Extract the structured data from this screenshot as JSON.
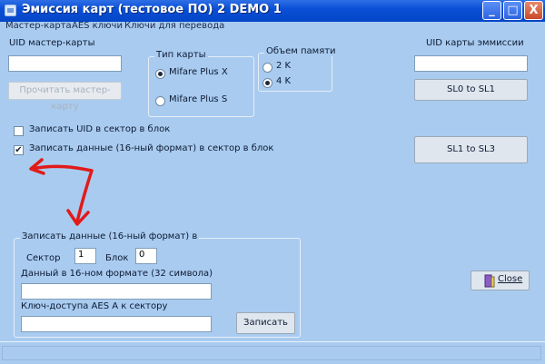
{
  "window": {
    "title": "Эмиссия карт (тестовое ПО) 2  DEMO 1",
    "minimize_glyph": "_",
    "maximize_glyph": "□",
    "close_glyph": "X"
  },
  "menu": {
    "items": [
      "Мастер-карта",
      "AES ключи",
      "Ключи для перевода"
    ]
  },
  "master": {
    "label": "UID мастер-карты",
    "value": "",
    "read_button": "Прочитать мастер-карту"
  },
  "card_type": {
    "title": "Тип карты",
    "options": [
      "Mifare Plus X",
      "Mifare Plus S"
    ],
    "selected": "Mifare Plus X"
  },
  "memory": {
    "title": "Объем памяти",
    "options": [
      "2 K",
      "4 K"
    ],
    "selected": "4 K"
  },
  "emission": {
    "label": "UID карты эммиссии",
    "value": "",
    "sl0_button": "SL0 to SL1",
    "sl1_button": "SL1 to SL3"
  },
  "checkboxes": {
    "write_uid": {
      "label": "Записать UID в сектор в блок",
      "checked": false,
      "mark": ""
    },
    "write_data": {
      "label": "Записать данные (16-ный формат) в сектор в блок",
      "checked": true,
      "mark": "✔"
    }
  },
  "write_group": {
    "title": "Записать данные (16-ный формат) в",
    "sector_label": "Сектор",
    "sector_value": "1",
    "block_label": "Блок",
    "block_value": "0",
    "data_label": "Данный в 16-ном формате (32 символа)",
    "data_value": "",
    "key_label": "Ключ-доступа AES A к сектору",
    "key_value": "",
    "write_button": "Записать"
  },
  "close_button": "Close",
  "colors": {
    "window_bg": "#a9cbef",
    "titlebar": "#0a4fd6",
    "arrow": "#e21a1a"
  }
}
